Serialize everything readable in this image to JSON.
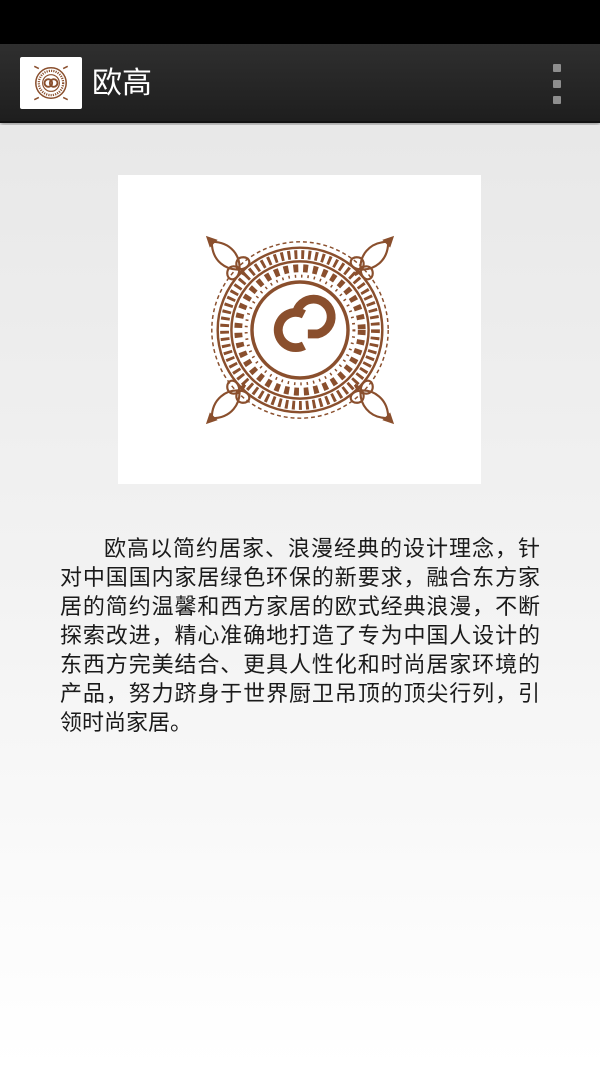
{
  "app_bar": {
    "title": "欧高",
    "icon": "ougao-logo-icon",
    "menu_icon": "overflow-menu-icon"
  },
  "brand": {
    "logo": "ougao-emblem-logo",
    "color": "#8a4f2d"
  },
  "content": {
    "description": "欧高以简约居家、浪漫经典的设计理念，针对中国国内家居绿色环保的新要求，融合东方家居的简约温馨和西方家居的欧式经典浪漫，不断探索改进，精心准确地打造了专为中国人设计的东西方完美结合、更具人性化和时尚居家环境的产品，努力跻身于世界厨卫吊顶的顶尖行列，引领时尚家居。"
  }
}
